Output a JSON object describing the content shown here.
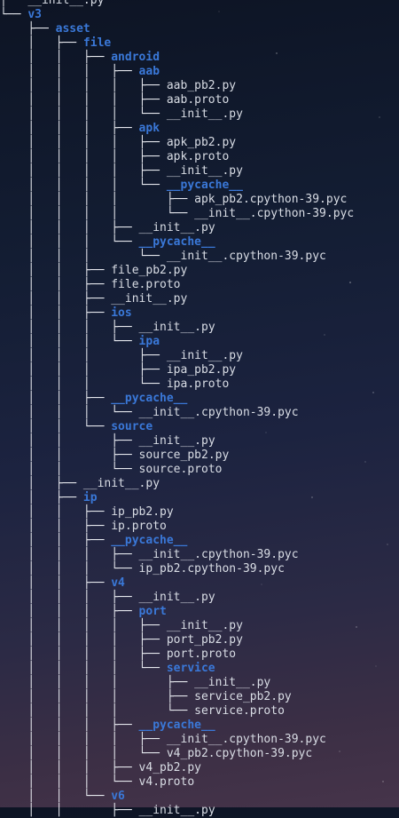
{
  "colors": {
    "directory": "#3a78d8",
    "file": "#d9dde5",
    "tree_lines": "#e6e8ee",
    "background_top": "#0d1424",
    "background_bottom": "#46344a"
  },
  "tree": {
    "rows": [
      {
        "prefix": "│   ",
        "name": "__init__.py",
        "type": "file",
        "partial": true
      },
      {
        "prefix": "└── ",
        "name": "v3",
        "type": "dir"
      },
      {
        "prefix": "    ├── ",
        "name": "asset",
        "type": "dir"
      },
      {
        "prefix": "    │   ├── ",
        "name": "file",
        "type": "dir"
      },
      {
        "prefix": "    │   │   ├── ",
        "name": "android",
        "type": "dir"
      },
      {
        "prefix": "    │   │   │   ├── ",
        "name": "aab",
        "type": "dir"
      },
      {
        "prefix": "    │   │   │   │   ├── ",
        "name": "aab_pb2.py",
        "type": "file"
      },
      {
        "prefix": "    │   │   │   │   ├── ",
        "name": "aab.proto",
        "type": "file"
      },
      {
        "prefix": "    │   │   │   │   └── ",
        "name": "__init__.py",
        "type": "file"
      },
      {
        "prefix": "    │   │   │   ├── ",
        "name": "apk",
        "type": "dir"
      },
      {
        "prefix": "    │   │   │   │   ├── ",
        "name": "apk_pb2.py",
        "type": "file"
      },
      {
        "prefix": "    │   │   │   │   ├── ",
        "name": "apk.proto",
        "type": "file"
      },
      {
        "prefix": "    │   │   │   │   ├── ",
        "name": "__init__.py",
        "type": "file"
      },
      {
        "prefix": "    │   │   │   │   └── ",
        "name": "__pycache__",
        "type": "dir"
      },
      {
        "prefix": "    │   │   │   │       ├── ",
        "name": "apk_pb2.cpython-39.pyc",
        "type": "file"
      },
      {
        "prefix": "    │   │   │   │       └── ",
        "name": "__init__.cpython-39.pyc",
        "type": "file"
      },
      {
        "prefix": "    │   │   │   ├── ",
        "name": "__init__.py",
        "type": "file"
      },
      {
        "prefix": "    │   │   │   └── ",
        "name": "__pycache__",
        "type": "dir"
      },
      {
        "prefix": "    │   │   │       └── ",
        "name": "__init__.cpython-39.pyc",
        "type": "file"
      },
      {
        "prefix": "    │   │   ├── ",
        "name": "file_pb2.py",
        "type": "file"
      },
      {
        "prefix": "    │   │   ├── ",
        "name": "file.proto",
        "type": "file"
      },
      {
        "prefix": "    │   │   ├── ",
        "name": "__init__.py",
        "type": "file"
      },
      {
        "prefix": "    │   │   ├── ",
        "name": "ios",
        "type": "dir"
      },
      {
        "prefix": "    │   │   │   ├── ",
        "name": "__init__.py",
        "type": "file"
      },
      {
        "prefix": "    │   │   │   └── ",
        "name": "ipa",
        "type": "dir"
      },
      {
        "prefix": "    │   │   │       ├── ",
        "name": "__init__.py",
        "type": "file"
      },
      {
        "prefix": "    │   │   │       ├── ",
        "name": "ipa_pb2.py",
        "type": "file"
      },
      {
        "prefix": "    │   │   │       └── ",
        "name": "ipa.proto",
        "type": "file"
      },
      {
        "prefix": "    │   │   ├── ",
        "name": "__pycache__",
        "type": "dir"
      },
      {
        "prefix": "    │   │   │   └── ",
        "name": "__init__.cpython-39.pyc",
        "type": "file"
      },
      {
        "prefix": "    │   │   └── ",
        "name": "source",
        "type": "dir"
      },
      {
        "prefix": "    │   │       ├── ",
        "name": "__init__.py",
        "type": "file"
      },
      {
        "prefix": "    │   │       ├── ",
        "name": "source_pb2.py",
        "type": "file"
      },
      {
        "prefix": "    │   │       └── ",
        "name": "source.proto",
        "type": "file"
      },
      {
        "prefix": "    │   ├── ",
        "name": "__init__.py",
        "type": "file"
      },
      {
        "prefix": "    │   ├── ",
        "name": "ip",
        "type": "dir"
      },
      {
        "prefix": "    │   │   ├── ",
        "name": "ip_pb2.py",
        "type": "file"
      },
      {
        "prefix": "    │   │   ├── ",
        "name": "ip.proto",
        "type": "file"
      },
      {
        "prefix": "    │   │   ├── ",
        "name": "__pycache__",
        "type": "dir"
      },
      {
        "prefix": "    │   │   │   ├── ",
        "name": "__init__.cpython-39.pyc",
        "type": "file"
      },
      {
        "prefix": "    │   │   │   └── ",
        "name": "ip_pb2.cpython-39.pyc",
        "type": "file"
      },
      {
        "prefix": "    │   │   ├── ",
        "name": "v4",
        "type": "dir"
      },
      {
        "prefix": "    │   │   │   ├── ",
        "name": "__init__.py",
        "type": "file"
      },
      {
        "prefix": "    │   │   │   ├── ",
        "name": "port",
        "type": "dir"
      },
      {
        "prefix": "    │   │   │   │   ├── ",
        "name": "__init__.py",
        "type": "file"
      },
      {
        "prefix": "    │   │   │   │   ├── ",
        "name": "port_pb2.py",
        "type": "file"
      },
      {
        "prefix": "    │   │   │   │   ├── ",
        "name": "port.proto",
        "type": "file"
      },
      {
        "prefix": "    │   │   │   │   └── ",
        "name": "service",
        "type": "dir"
      },
      {
        "prefix": "    │   │   │   │       ├── ",
        "name": "__init__.py",
        "type": "file"
      },
      {
        "prefix": "    │   │   │   │       ├── ",
        "name": "service_pb2.py",
        "type": "file"
      },
      {
        "prefix": "    │   │   │   │       └── ",
        "name": "service.proto",
        "type": "file"
      },
      {
        "prefix": "    │   │   │   ├── ",
        "name": "__pycache__",
        "type": "dir"
      },
      {
        "prefix": "    │   │   │   │   ├── ",
        "name": "__init__.cpython-39.pyc",
        "type": "file"
      },
      {
        "prefix": "    │   │   │   │   └── ",
        "name": "v4_pb2.cpython-39.pyc",
        "type": "file"
      },
      {
        "prefix": "    │   │   │   ├── ",
        "name": "v4_pb2.py",
        "type": "file"
      },
      {
        "prefix": "    │   │   │   └── ",
        "name": "v4.proto",
        "type": "file"
      },
      {
        "prefix": "    │   │   └── ",
        "name": "v6",
        "type": "dir"
      },
      {
        "prefix": "    │   │       ├── ",
        "name": "__init__.py",
        "type": "file"
      }
    ]
  }
}
